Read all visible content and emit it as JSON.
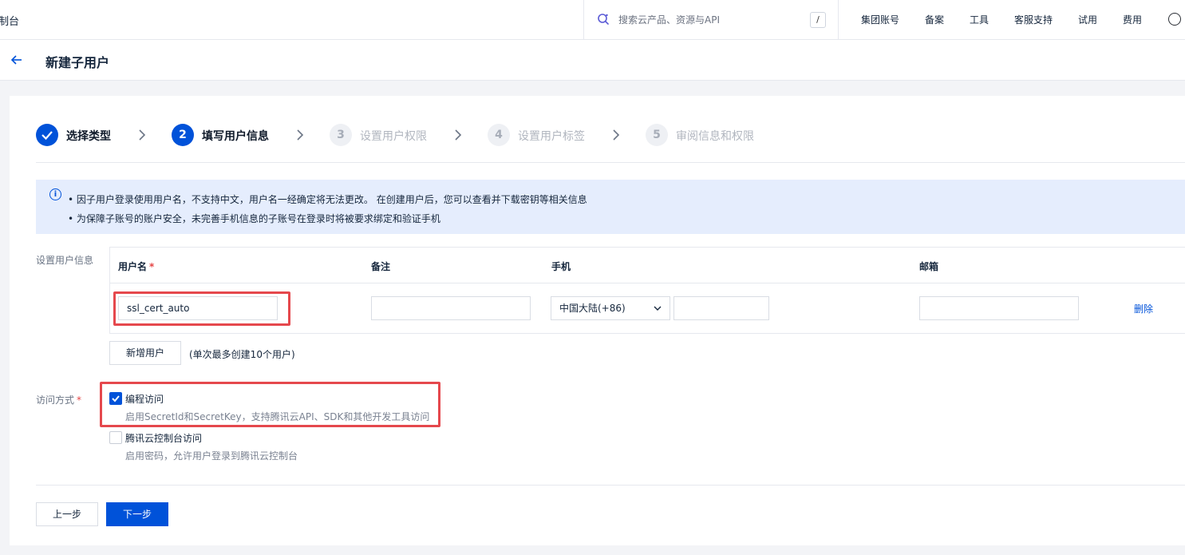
{
  "topbar": {
    "brand_tail": "制台",
    "search_placeholder": "搜索云产品、资源与API",
    "search_shortcut": "/",
    "nav": [
      "集团账号",
      "备案",
      "工具",
      "客服支持",
      "试用",
      "费用"
    ]
  },
  "header": {
    "title": "新建子用户"
  },
  "steps": [
    {
      "index": "",
      "label": "选择类型",
      "state": "done"
    },
    {
      "index": "2",
      "label": "填写用户信息",
      "state": "active"
    },
    {
      "index": "3",
      "label": "设置用户权限",
      "state": "pending"
    },
    {
      "index": "4",
      "label": "设置用户标签",
      "state": "pending"
    },
    {
      "index": "5",
      "label": "审阅信息和权限",
      "state": "pending"
    }
  ],
  "notice": {
    "line1": "• 因子用户登录使用用户名，不支持中文，用户名一经确定将无法更改。 在创建用户后，您可以查看并下载密钥等相关信息",
    "line2": "• 为保障子账号的账户安全，未完善手机信息的子账号在登录时将被要求绑定和验证手机"
  },
  "user_info": {
    "section_label": "设置用户信息",
    "columns": {
      "username": "用户名",
      "note": "备注",
      "phone": "手机",
      "email": "邮箱"
    },
    "row": {
      "username": "ssl_cert_auto",
      "note": "",
      "phone_region": "中国大陆(+86)",
      "phone": "",
      "email": "",
      "delete": "删除"
    },
    "add_user": "新增用户",
    "add_hint": "(单次最多创建10个用户)"
  },
  "access": {
    "section_label": "访问方式",
    "options": [
      {
        "title": "编程访问",
        "desc": "启用SecretId和SecretKey，支持腾讯云API、SDK和其他开发工具访问",
        "checked": true
      },
      {
        "title": "腾讯云控制台访问",
        "desc": "启用密码，允许用户登录到腾讯云控制台",
        "checked": false
      }
    ]
  },
  "footer": {
    "prev": "上一步",
    "next": "下一步"
  },
  "colors": {
    "primary": "#0052d9",
    "highlight": "#e5484d",
    "notice_bg": "#e5edfd"
  }
}
